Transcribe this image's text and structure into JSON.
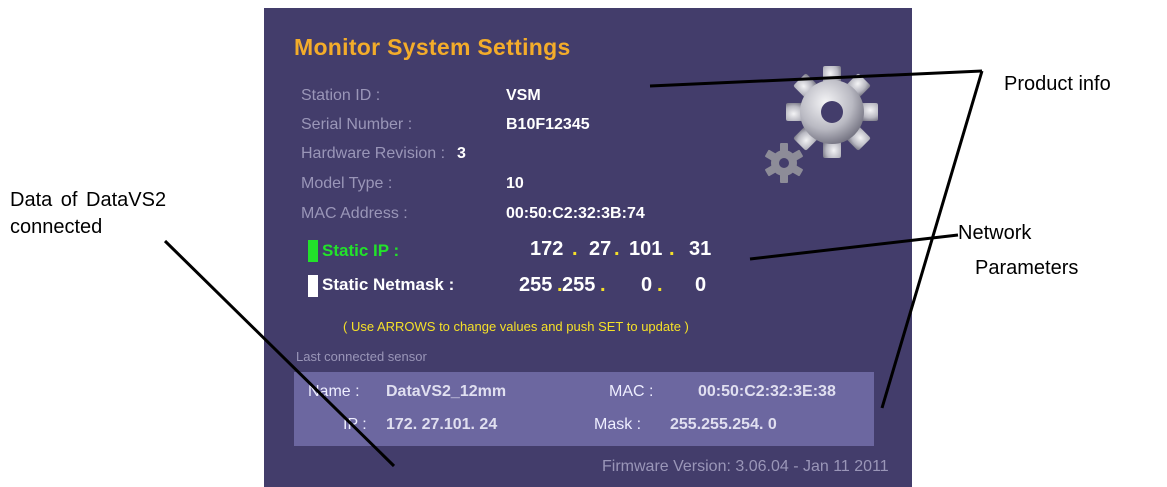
{
  "panel": {
    "title": "Monitor System Settings",
    "product": {
      "station_id_label": "Station ID :",
      "station_id": "VSM",
      "serial_label": "Serial Number :",
      "serial": "B10F12345",
      "hw_label": "Hardware Revision :",
      "hw": "3",
      "model_label": "Model Type :",
      "model": "10",
      "mac_label": "MAC Address :",
      "mac": "00:50:C2:32:3B:74"
    },
    "network": {
      "ip_label": "Static IP :",
      "ip": [
        "172",
        "27",
        "101",
        "31"
      ],
      "mask_label": "Static Netmask :",
      "mask": [
        "255",
        "255",
        "0",
        "0"
      ],
      "dot": ".",
      "hint": "( Use ARROWS to change values and push SET to update )"
    },
    "last_sensor": {
      "heading": "Last connected sensor",
      "name_label": "Name :",
      "name": "DataVS2_12mm",
      "mac_label": "MAC :",
      "mac": "00:50:C2:32:3E:38",
      "ip_label": "IP :",
      "ip": "172. 27.101. 24",
      "mask_label": "Mask :",
      "mask": "255.255.254. 0"
    },
    "firmware": "Firmware Version: 3.06.04 - Jan 11 2011"
  },
  "callouts": {
    "product_info": "Product info",
    "network_line1": "Network",
    "network_line2": "Parameters",
    "data_line1": "Data  of  DataVS2",
    "data_line2": "connected"
  },
  "colors": {
    "panel_bg": "#433d6b",
    "title": "#f3ac2a",
    "highlight_green": "#22e22a",
    "hint_yellow": "#f5e028",
    "sensor_box": "#6c67a0"
  },
  "icons": [
    "gear-icon"
  ]
}
